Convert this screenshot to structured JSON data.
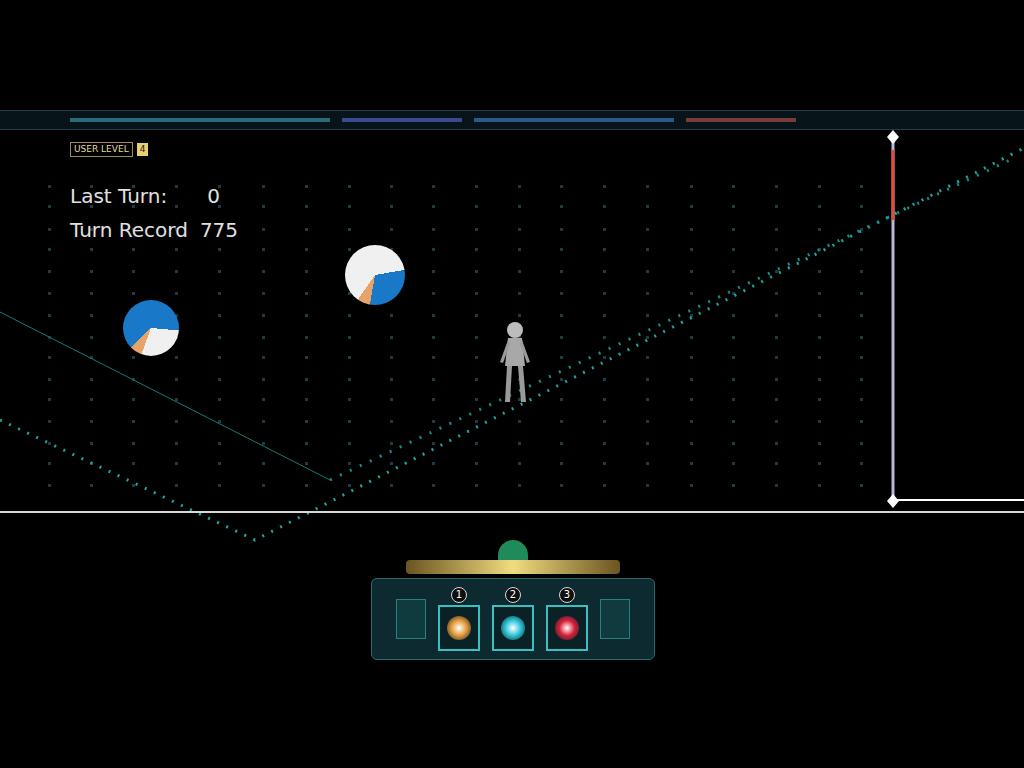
{
  "hud": {
    "level_label": "USER LEVEL",
    "level": "4",
    "last_turn_label": "Last Turn:",
    "last_turn": "0",
    "record_label": "Turn Record",
    "record": "775"
  },
  "hand": [
    {
      "number": "1",
      "color": "#e59a3a"
    },
    {
      "number": "2",
      "color": "#2fc6d8"
    },
    {
      "number": "3",
      "color": "#d8203a"
    }
  ]
}
